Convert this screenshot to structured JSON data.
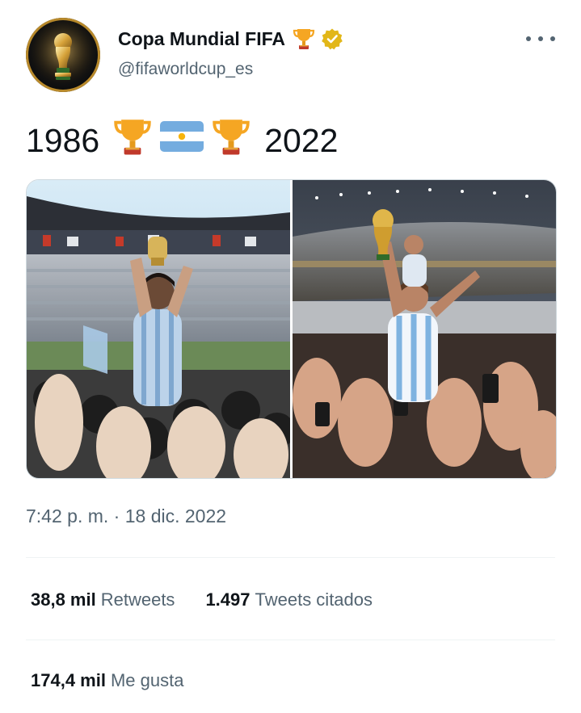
{
  "author": {
    "display_name": "Copa Mundial FIFA",
    "handle": "@fifaworldcup_es",
    "name_emoji_icon": "trophy-icon",
    "verified_icon": "verified-badge-icon",
    "verified_color": "#e2b719"
  },
  "tweet": {
    "text_year_start": "1986",
    "text_year_end": "2022",
    "emoji_sequence": [
      "trophy",
      "flag-argentina",
      "trophy"
    ],
    "timestamp": "7:42 p. m. · 18 dic. 2022"
  },
  "stats": {
    "retweets_count": "38,8 mil",
    "retweets_label": "Retweets",
    "quotes_count": "1.497",
    "quotes_label": "Tweets citados",
    "likes_count": "174,4 mil",
    "likes_label": "Me gusta"
  },
  "colors": {
    "text_primary": "#0f1419",
    "text_secondary": "#536471",
    "divider": "#eff3f4"
  }
}
